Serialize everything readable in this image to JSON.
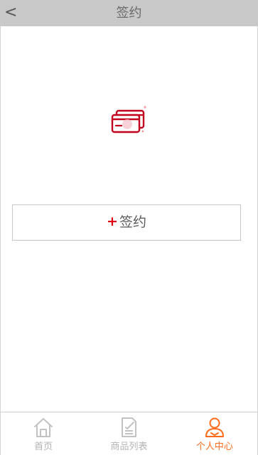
{
  "header": {
    "back_label": "<",
    "title": "签约"
  },
  "main": {
    "card_icon": "credit-card-icon",
    "sign_button": {
      "plus": "+",
      "label": "签约"
    }
  },
  "tabbar": {
    "tabs": [
      {
        "label": "首页",
        "icon": "home-icon",
        "active": false
      },
      {
        "label": "商品列表",
        "icon": "document-list-icon",
        "active": false
      },
      {
        "label": "个人中心",
        "icon": "user-icon",
        "active": true
      }
    ]
  },
  "colors": {
    "header_bg": "#c8c8c8",
    "accent": "#ff6a1a",
    "plus_red": "#e00012",
    "card_red": "#c4001f",
    "inactive": "#b3b3b3"
  }
}
